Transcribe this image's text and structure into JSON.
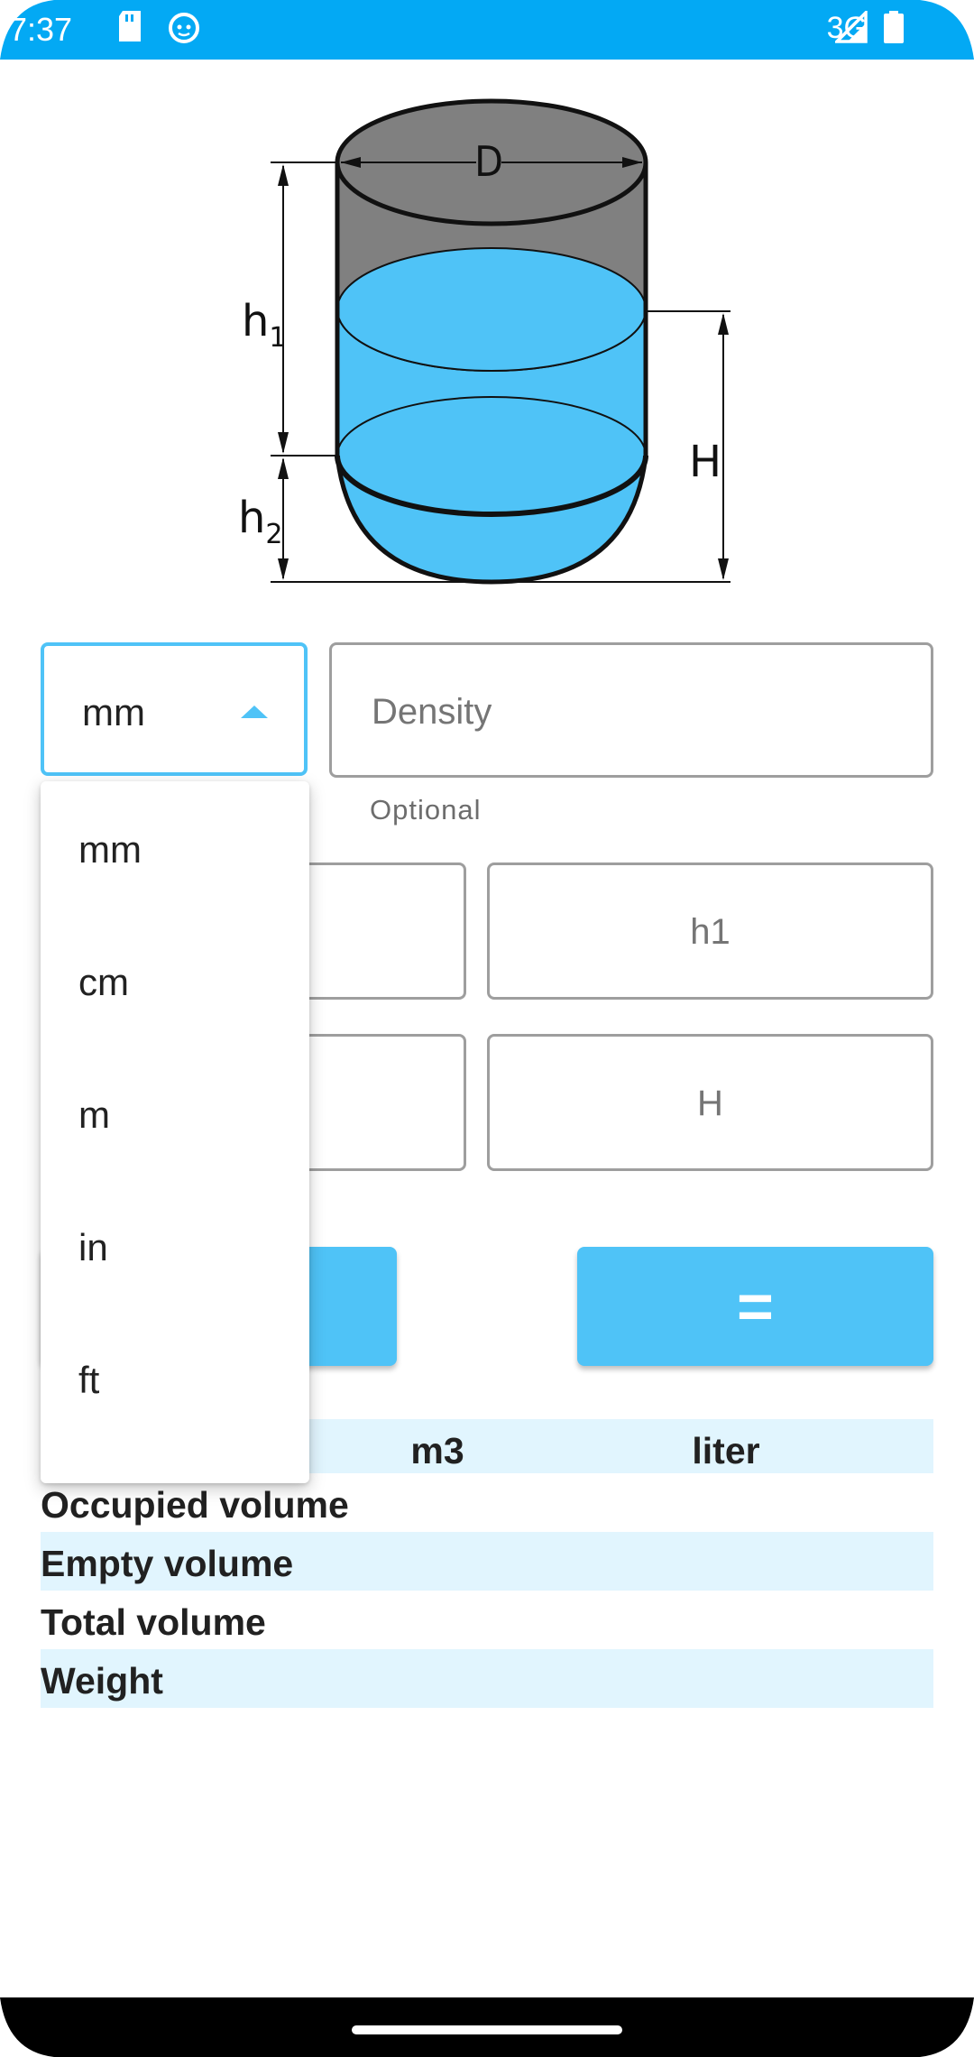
{
  "status_bar": {
    "time": "7:37",
    "network": "3G",
    "icons": [
      "sd-card-icon",
      "cat-face-icon",
      "signal-icon",
      "battery-icon"
    ]
  },
  "diagram": {
    "labels": {
      "diameter": "D",
      "h1": "h",
      "h1_sub": "1",
      "h2": "h",
      "h2_sub": "2",
      "height": "H"
    },
    "colors": {
      "liquid": "#4fc3f7",
      "empty": "#808080",
      "outline": "#111111"
    }
  },
  "unit_select": {
    "value": "mm",
    "options": [
      "mm",
      "cm",
      "m",
      "in",
      "ft"
    ]
  },
  "density_field": {
    "placeholder": "Density",
    "helper": "Optional"
  },
  "inputs": {
    "h1_placeholder": "h1",
    "H_placeholder": "H"
  },
  "buttons": {
    "equals_label": "="
  },
  "results": {
    "headers": [
      "",
      "m3",
      "liter"
    ],
    "rows": [
      "Occupied volume",
      "Empty volume",
      "Total volume",
      "Weight"
    ]
  },
  "colors": {
    "accent": "#4fc3f7",
    "status_bar": "#03a9f4",
    "row_alt": "#e1f5fe"
  }
}
